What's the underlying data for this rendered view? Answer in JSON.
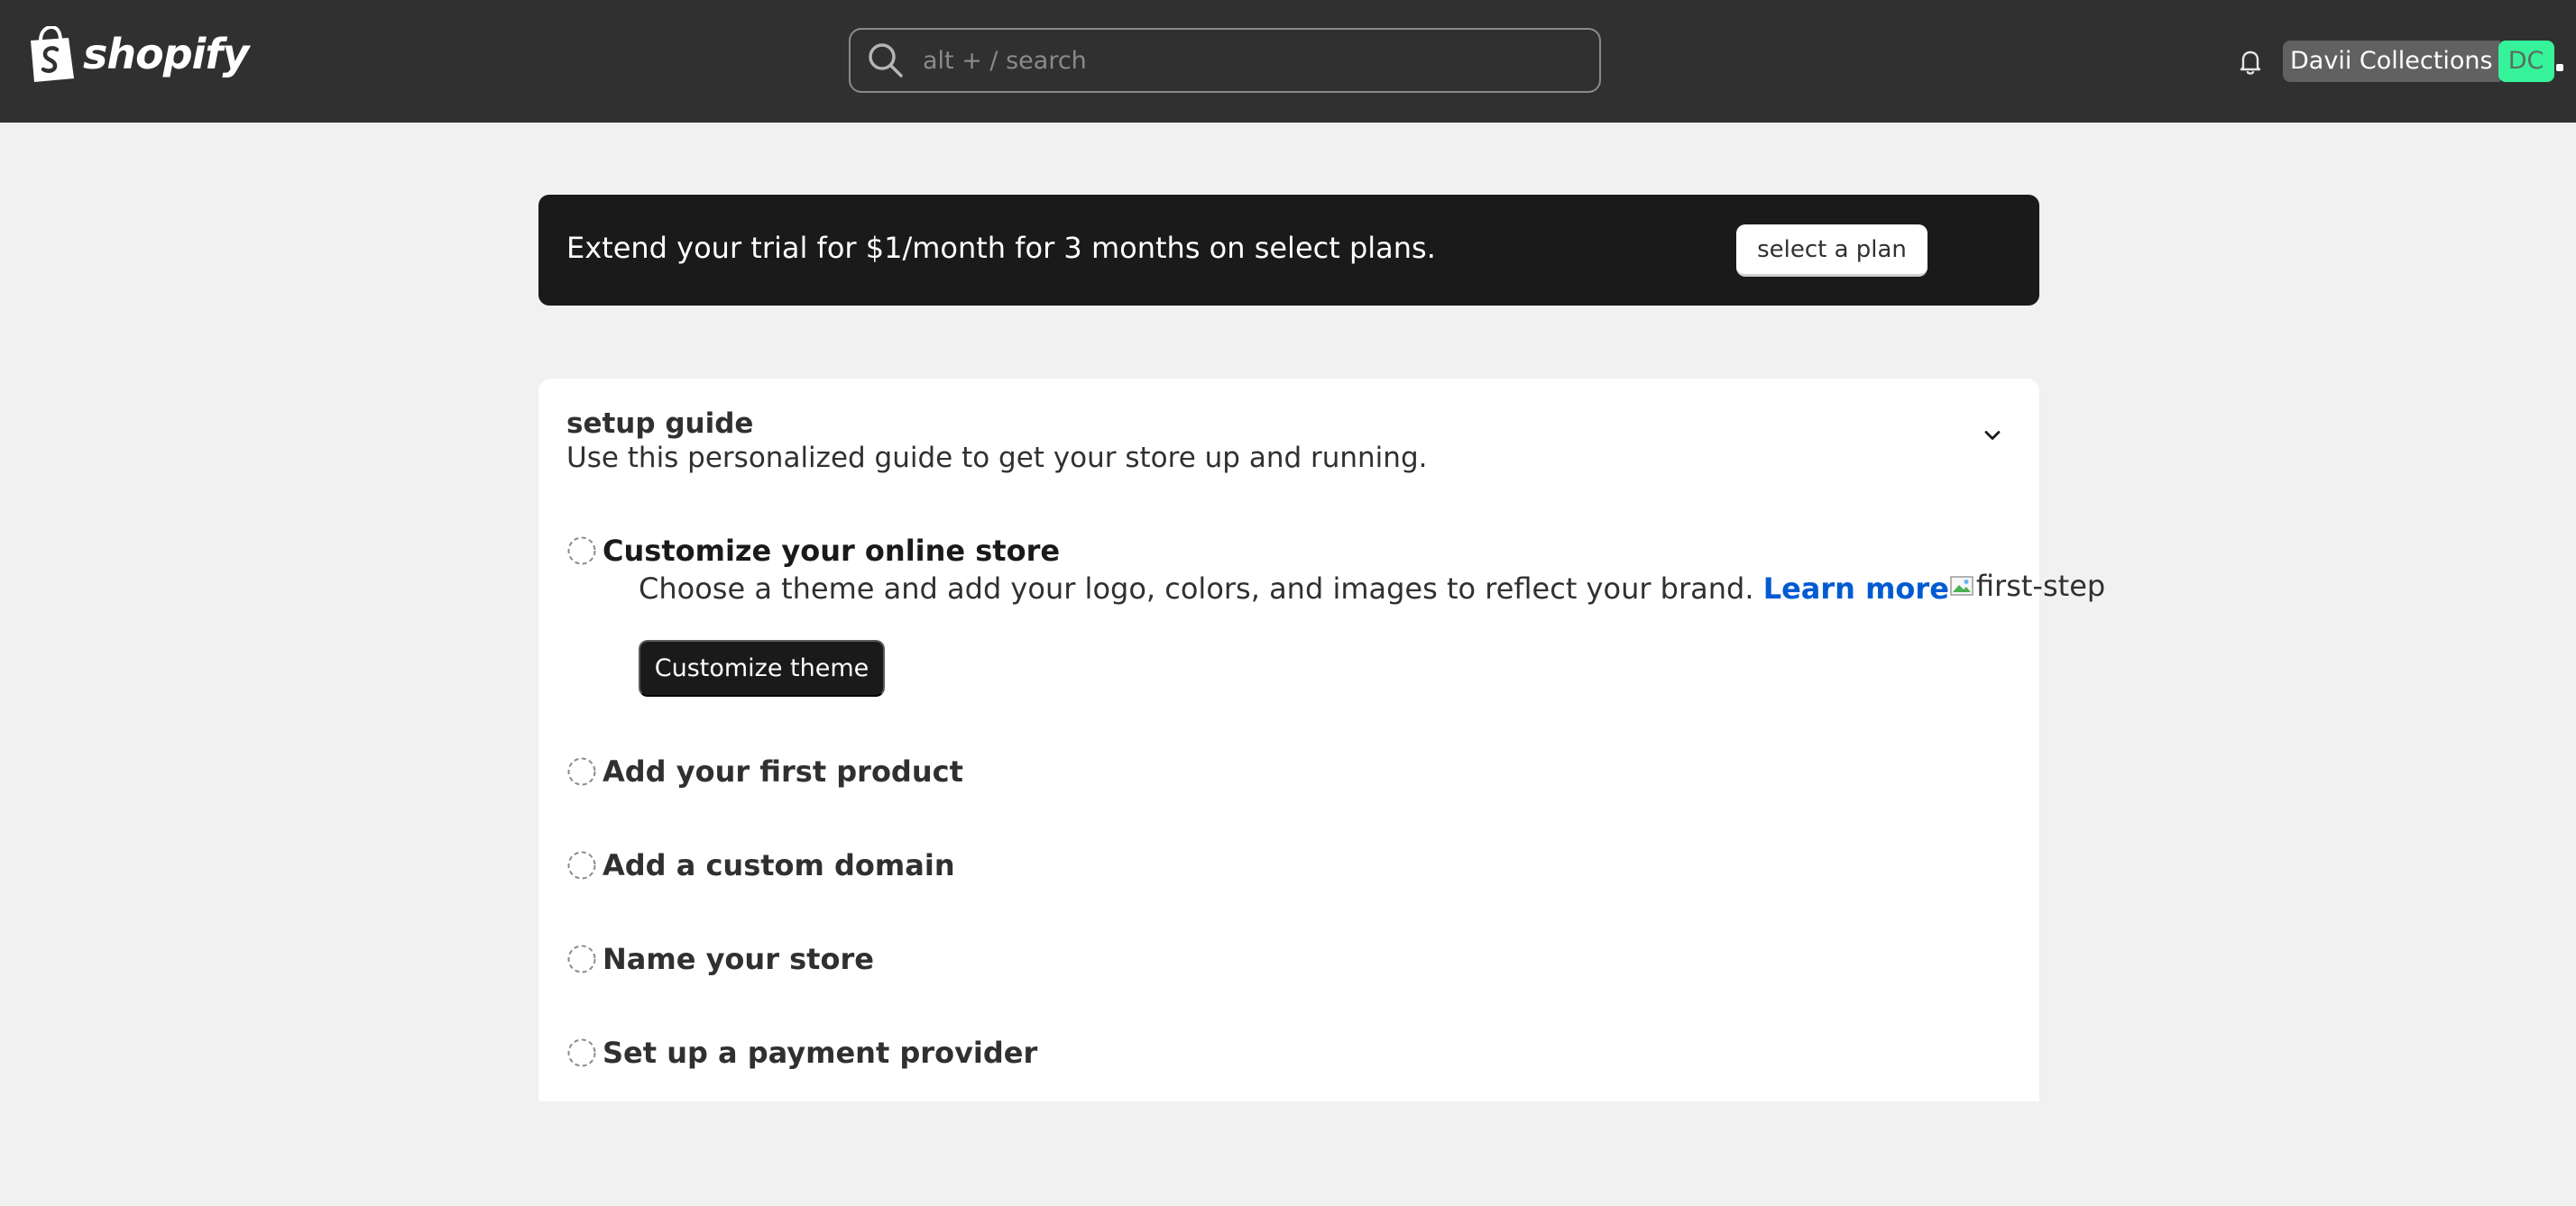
{
  "topbar": {
    "logo_text": "shopify",
    "search": {
      "placeholder": "alt + / search"
    },
    "account": {
      "store_name": "Davii Collections",
      "initials": "DC"
    },
    "colors": {
      "background": "#303030",
      "avatar": "#36f39b"
    }
  },
  "banner": {
    "text": "Extend your trial for $1/month for 3 months on select plans.",
    "button_label": "select a plan"
  },
  "setup_guide": {
    "title": "setup guide",
    "subtitle": "Use this personalized guide to get your store up and running.",
    "tasks": [
      {
        "title": "Customize your online store",
        "expanded": true,
        "completed": false,
        "description": "Choose a theme and add your logo, colors, and images to reflect your brand.",
        "link_text": "Learn more",
        "image_alt": "first-step",
        "button_label": "Customize theme"
      },
      {
        "title": "Add your first product",
        "expanded": false,
        "completed": false
      },
      {
        "title": "Add a custom domain",
        "expanded": false,
        "completed": false
      },
      {
        "title": "Name your store",
        "expanded": false,
        "completed": false
      },
      {
        "title": "Set up a payment provider",
        "expanded": false,
        "completed": false
      }
    ]
  },
  "colors": {
    "page_background": "#f1f1f1",
    "banner_background": "#1a1a1a",
    "link": "#005bd3",
    "primary_button": "#1a1a1a"
  },
  "icons": {
    "notifications": "bell-icon",
    "search": "search-icon",
    "collapse": "chevron-down-icon",
    "task_status": "dashed-circle-icon"
  }
}
